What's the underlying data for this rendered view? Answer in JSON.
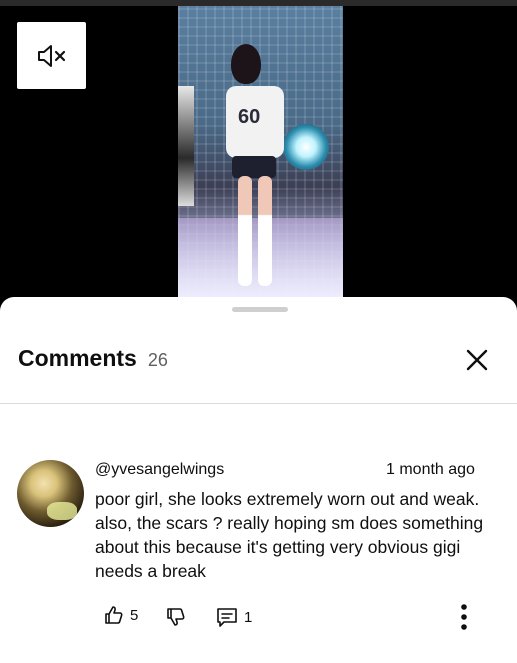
{
  "video": {
    "mute_icon": "speaker-muted-icon",
    "jersey_number": "60"
  },
  "comments_panel": {
    "title": "Comments",
    "count": "26",
    "close_icon": "close-icon"
  },
  "comment": {
    "author": "@yvesangelwings",
    "time": "1 month ago",
    "text": "poor girl, she looks extremely worn out and weak. also, the scars ? really hoping sm does something about this because it's getting very obvious gigi needs a break",
    "likes": "5",
    "replies": "1",
    "icons": {
      "like": "thumbs-up-icon",
      "dislike": "thumbs-down-icon",
      "reply": "reply-icon",
      "more": "more-vertical-icon"
    }
  }
}
